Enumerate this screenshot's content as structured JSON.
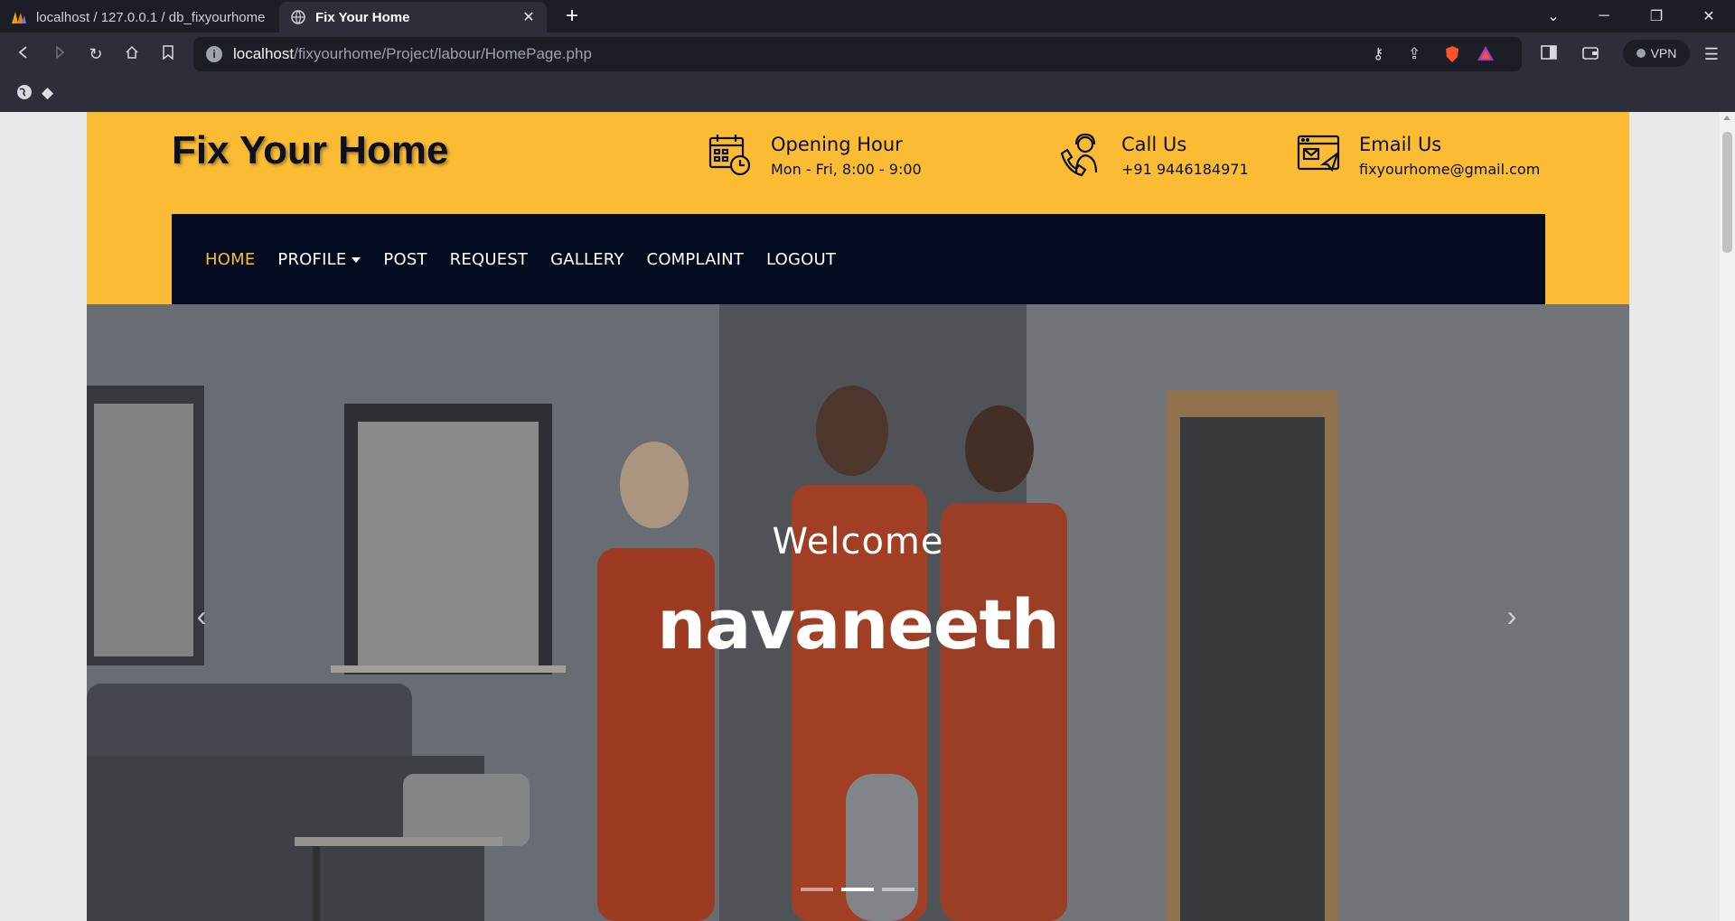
{
  "browser": {
    "tabs": [
      {
        "label": "localhost / 127.0.0.1 / db_fixyourhome",
        "active": false
      },
      {
        "label": "Fix Your Home",
        "active": true
      }
    ],
    "url_host": "localhost",
    "url_path": "/fixyourhome/Project/labour/HomePage.php",
    "vpn_label": "VPN"
  },
  "site": {
    "brand": "Fix Your Home",
    "info": [
      {
        "icon": "calendar-clock-icon",
        "title": "Opening Hour",
        "sub": "Mon - Fri, 8:00 - 9:00"
      },
      {
        "icon": "support-agent-icon",
        "title": "Call Us",
        "sub": "+91 9446184971"
      },
      {
        "icon": "email-window-icon",
        "title": "Email Us",
        "sub": "fixyourhome@gmail.com"
      }
    ],
    "nav": [
      "HOME",
      "PROFILE",
      "POST",
      "REQUEST",
      "GALLERY",
      "COMPLAINT",
      "LOGOUT"
    ],
    "active_nav": "HOME",
    "hero": {
      "welcome": "Welcome",
      "name": "navaneeth",
      "slides": 3,
      "active_slide": 2
    },
    "colors": {
      "accent": "#fbbc33",
      "navbar": "#020b1f",
      "hero_overlay": "#7b8087"
    }
  }
}
